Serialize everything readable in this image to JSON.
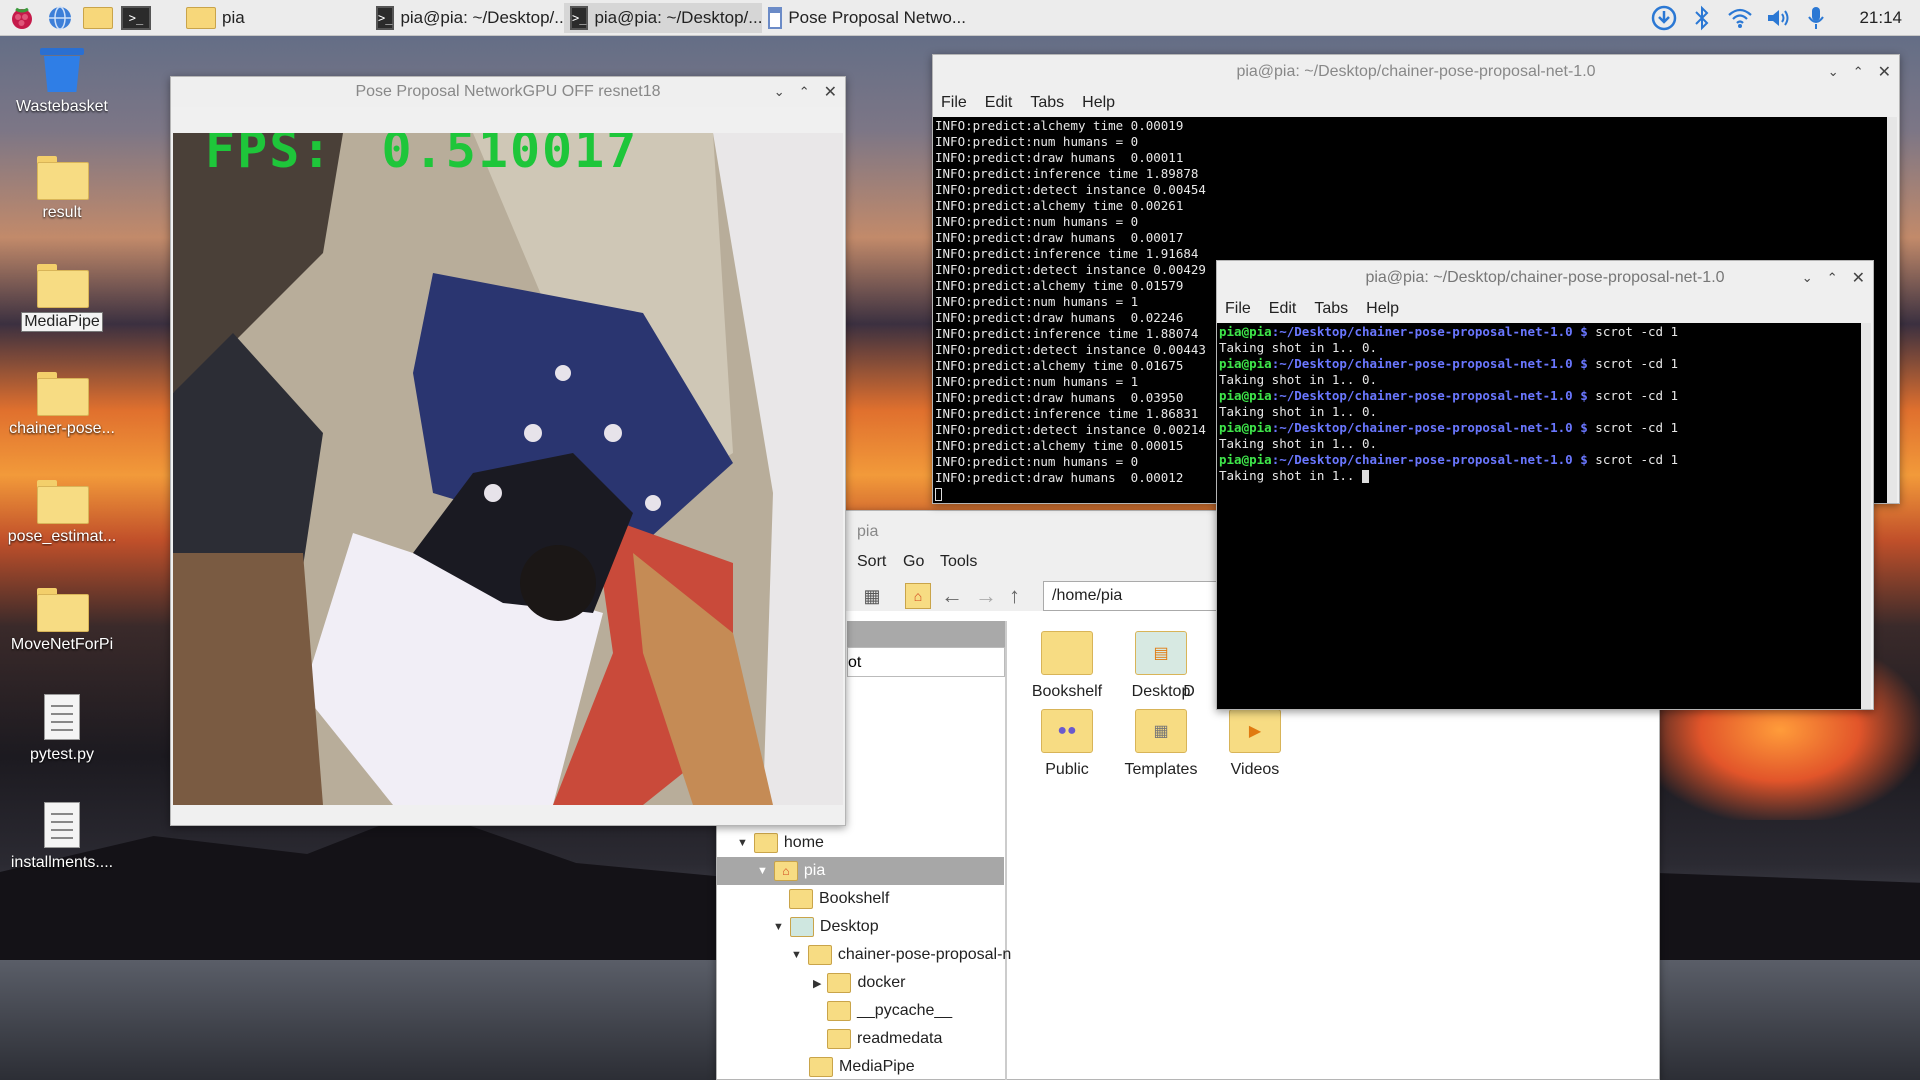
{
  "taskbar": {
    "tasks": [
      {
        "label": "pia"
      },
      {
        "label": "pia@pia: ~/Desktop/..."
      },
      {
        "label": "pia@pia: ~/Desktop/..."
      },
      {
        "label": "Pose Proposal Netwo..."
      }
    ],
    "clock": "21:14"
  },
  "desktop": {
    "icons": [
      {
        "label": "Wastebasket"
      },
      {
        "label": "result"
      },
      {
        "label": "MediaPipe"
      },
      {
        "label": "chainer-pose..."
      },
      {
        "label": "pose_estimat..."
      },
      {
        "label": "MoveNetForPi"
      },
      {
        "label": "pytest.py"
      },
      {
        "label": "installments...."
      }
    ]
  },
  "pose_window": {
    "title": "Pose Proposal NetworkGPU OFF resnet18",
    "fps_label": "FPS:",
    "fps_value": "0.510017"
  },
  "terminal_back": {
    "title": "pia@pia: ~/Desktop/chainer-pose-proposal-net-1.0",
    "menu": [
      "File",
      "Edit",
      "Tabs",
      "Help"
    ],
    "lines": [
      "INFO:predict:alchemy time 0.00019",
      "INFO:predict:num humans = 0",
      "INFO:predict:draw humans  0.00011",
      "INFO:predict:inference time 1.89878",
      "INFO:predict:detect instance 0.00454",
      "INFO:predict:alchemy time 0.00261",
      "INFO:predict:num humans = 0",
      "INFO:predict:draw humans  0.00017",
      "INFO:predict:inference time 1.91684",
      "INFO:predict:detect instance 0.00429",
      "INFO:predict:alchemy time 0.01579",
      "INFO:predict:num humans = 1",
      "INFO:predict:draw humans  0.02246",
      "INFO:predict:inference time 1.88074",
      "INFO:predict:detect instance 0.00443",
      "INFO:predict:alchemy time 0.01675",
      "INFO:predict:num humans = 1",
      "INFO:predict:draw humans  0.03950",
      "INFO:predict:inference time 1.86831",
      "INFO:predict:detect instance 0.00214",
      "INFO:predict:alchemy time 0.00015",
      "INFO:predict:num humans = 0",
      "INFO:predict:draw humans  0.00012"
    ]
  },
  "terminal_front": {
    "title": "pia@pia: ~/Desktop/chainer-pose-proposal-net-1.0",
    "menu": [
      "File",
      "Edit",
      "Tabs",
      "Help"
    ],
    "prompt_user": "pia@pia",
    "prompt_path": ":~/Desktop/chainer-pose-proposal-net-1.0 $",
    "command": " scrot -cd 1",
    "output": "Taking shot in 1.. 0.",
    "last_output": "Taking shot in 1.. "
  },
  "file_manager": {
    "menu": [
      "Sort",
      "Go",
      "Tools"
    ],
    "path": "/home/pia",
    "side_text": "ot",
    "tree": [
      {
        "label": "home"
      },
      {
        "label": "pia"
      },
      {
        "label": "Bookshelf"
      },
      {
        "label": "Desktop"
      },
      {
        "label": "chainer-pose-proposal-n"
      },
      {
        "label": "docker"
      },
      {
        "label": "__pycache__"
      },
      {
        "label": "readmedata"
      },
      {
        "label": "MediaPipe"
      }
    ],
    "items": [
      {
        "label": "Bookshelf"
      },
      {
        "label": "Desktop"
      },
      {
        "label": "D"
      },
      {
        "label": "Public"
      },
      {
        "label": "Templates"
      },
      {
        "label": "Videos"
      }
    ]
  }
}
